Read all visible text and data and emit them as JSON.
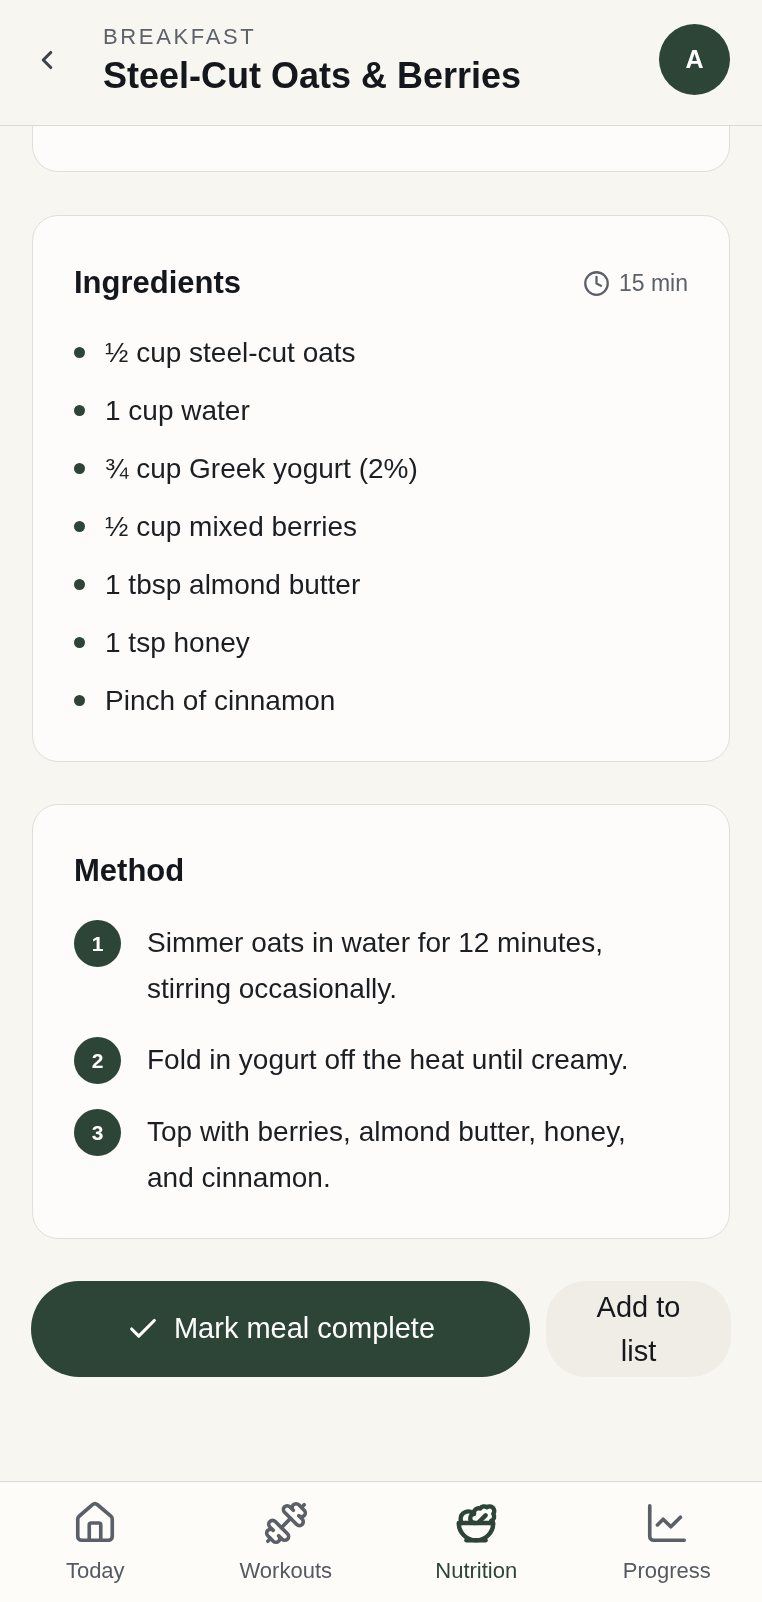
{
  "header": {
    "category": "BREAKFAST",
    "title": "Steel-Cut Oats & Berries",
    "avatar_initial": "A"
  },
  "ingredients": {
    "title": "Ingredients",
    "duration": "15 min",
    "items": [
      "½ cup steel-cut oats",
      "1 cup water",
      "¾ cup Greek yogurt (2%)",
      "½ cup mixed berries",
      "1 tbsp almond butter",
      "1 tsp honey",
      "Pinch of cinnamon"
    ]
  },
  "method": {
    "title": "Method",
    "steps": [
      {
        "number": "1",
        "text": "Simmer oats in water for 12 minutes, stirring occasionally."
      },
      {
        "number": "2",
        "text": "Fold in yogurt off the heat until creamy."
      },
      {
        "number": "3",
        "text": "Top with berries, almond butter, honey, and cinnamon."
      }
    ]
  },
  "actions": [
    {
      "kind": "primary",
      "label": "Mark meal complete"
    },
    {
      "kind": "secondary",
      "label": "Add to list"
    }
  ],
  "tab_bar": [
    {
      "kind": "home",
      "label": "Today",
      "selected": false
    },
    {
      "kind": "dumbbell",
      "label": "Workouts",
      "selected": false
    },
    {
      "kind": "salad",
      "label": "Nutrition",
      "selected": true
    },
    {
      "kind": "chart",
      "label": "Progress",
      "selected": false
    }
  ]
}
